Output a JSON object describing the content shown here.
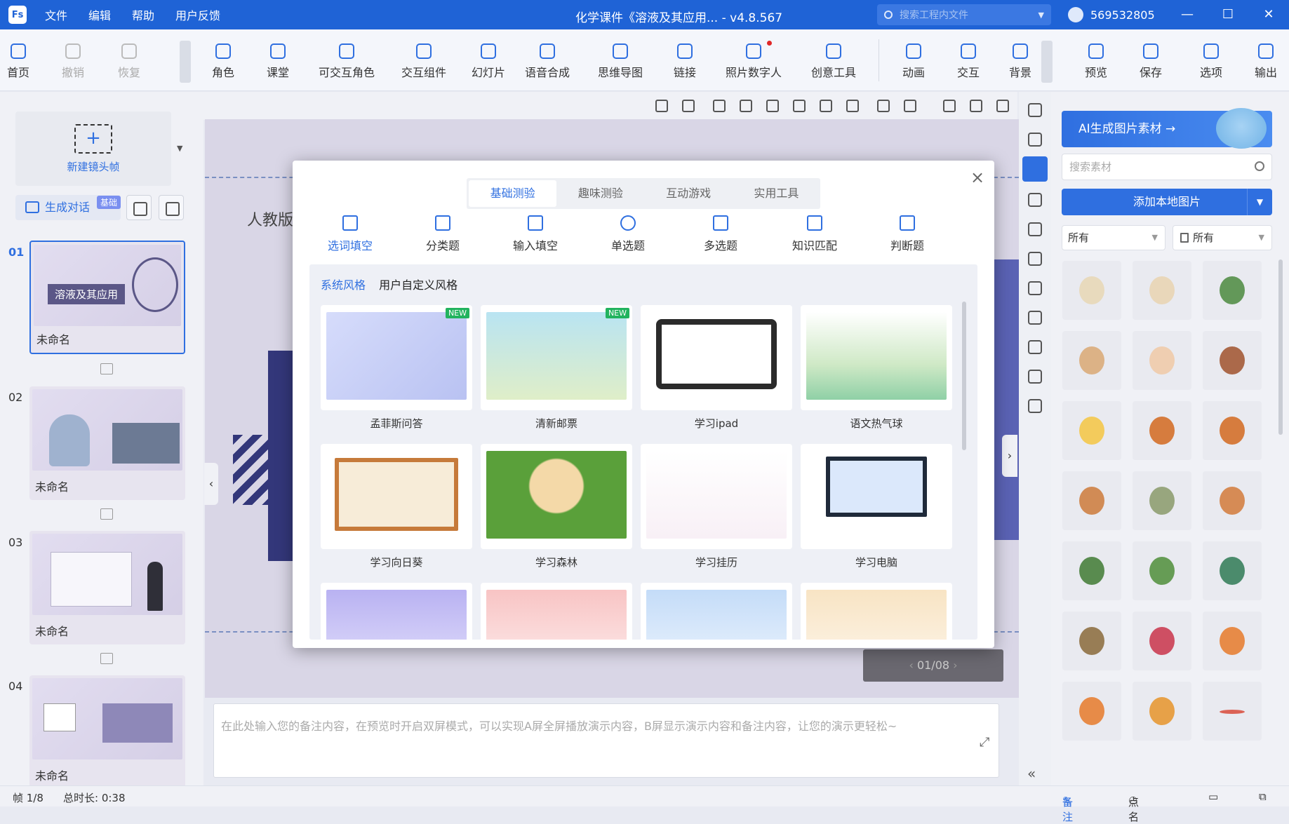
{
  "titlebar": {
    "logo": "Fs",
    "menu": [
      "文件",
      "编辑",
      "帮助",
      "用户反馈"
    ],
    "title": "化学课件《溶液及其应用... - v4.8.567",
    "search_placeholder": "搜索工程内文件",
    "account_id": "569532805"
  },
  "toolbar": {
    "items": [
      "首页",
      "撤销",
      "恢复",
      "角色",
      "课堂",
      "可交互角色",
      "交互组件",
      "幻灯片",
      "语音合成",
      "思维导图",
      "链接",
      "照片数字人",
      "创意工具",
      "动画",
      "交互",
      "背景",
      "预览",
      "保存",
      "选项",
      "输出"
    ]
  },
  "left_panel": {
    "new_shot": "新建镜头帧",
    "generate_dialog": "生成对话",
    "badge": "基础",
    "slides": [
      {
        "num": "01",
        "label": "未命名",
        "thumb_title": "溶液及其应用"
      },
      {
        "num": "02",
        "label": "未命名"
      },
      {
        "num": "03",
        "label": "未命名"
      },
      {
        "num": "04",
        "label": "未命名"
      }
    ]
  },
  "canvas": {
    "slide_text": "人教版",
    "pager": "01/08",
    "notes_placeholder": "在此处输入您的备注内容，在预览时开启双屏模式，可以实现A屏全屏播放演示内容，B屏显示演示内容和备注内容，让您的演示更轻松~"
  },
  "right_panel": {
    "ai_banner": "AI生成图片素材 →",
    "search_placeholder": "搜索素材",
    "add_local": "添加本地图片",
    "filter1": "所有",
    "filter2": "所有"
  },
  "statusbar": {
    "frame": "帧 1/8",
    "duration": "总时长: 0:38",
    "notes": "备注",
    "rollcall": "点名"
  },
  "modal": {
    "tabs": [
      "基础测验",
      "趣味测验",
      "互动游戏",
      "实用工具"
    ],
    "question_types": [
      "选词填空",
      "分类题",
      "输入填空",
      "单选题",
      "多选题",
      "知识匹配",
      "判断题"
    ],
    "style_tabs": [
      "系统风格",
      "用户自定义风格"
    ],
    "new_tag": "NEW",
    "templates": [
      "孟菲斯问答",
      "清新邮票",
      "学习ipad",
      "语文热气球",
      "学习向日葵",
      "学习森林",
      "学习挂历",
      "学习电脑"
    ]
  }
}
